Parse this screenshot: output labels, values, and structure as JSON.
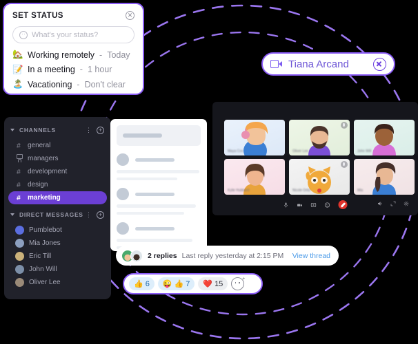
{
  "theme": {
    "background": "#000000",
    "accent_purple": "#8b5cf6",
    "channel_active": "#6b3fd4",
    "sidebar_bg": "#21222b",
    "link_blue": "#4a9ae8",
    "end_call_red": "#e0342c"
  },
  "status_popup": {
    "title": "SET STATUS",
    "close_icon": "close-circle-icon",
    "input": {
      "placeholder": "What's your status?",
      "value": "",
      "icon": "emoji-smile-icon"
    },
    "options": [
      {
        "emoji": "🏡",
        "label": "Working remotely",
        "separator": "-",
        "duration": "Today"
      },
      {
        "emoji": "📝",
        "label": "In a meeting",
        "separator": "-",
        "duration": "1 hour"
      },
      {
        "emoji": "🏝️",
        "label": "Vacationing",
        "separator": "-",
        "duration": "Don't clear"
      }
    ]
  },
  "call_badge": {
    "camera_icon": "video-camera-icon",
    "name": "Tiana Arcand",
    "close_icon": "close-circle-icon"
  },
  "sidebar": {
    "channels_section": {
      "title": "CHANNELS",
      "chevron_icon": "chevron-down-icon",
      "more_icon": "more-vertical-icon",
      "add_icon": "plus-circle-icon",
      "items": [
        {
          "name": "general",
          "icon": "hash-icon",
          "active": false
        },
        {
          "name": "managers",
          "icon": "lock-icon",
          "active": false
        },
        {
          "name": "development",
          "icon": "hash-icon",
          "active": false
        },
        {
          "name": "design",
          "icon": "hash-icon",
          "active": false
        },
        {
          "name": "marketing",
          "icon": "hash-icon",
          "active": true
        }
      ]
    },
    "dm_section": {
      "title": "DIRECT MESSAGES",
      "chevron_icon": "chevron-down-icon",
      "more_icon": "more-vertical-icon",
      "add_icon": "plus-circle-icon",
      "items": [
        {
          "name": "Pumblebot",
          "avatar_color": "#5b6ee0"
        },
        {
          "name": "Mia Jones",
          "avatar_color": "#8c9fbf"
        },
        {
          "name": "Eric Till",
          "avatar_color": "#cbb27a"
        },
        {
          "name": "John Will",
          "avatar_color": "#7c8fa8"
        },
        {
          "name": "Oliver Lee",
          "avatar_color": "#9a8a78"
        }
      ]
    }
  },
  "message_skeleton": {
    "placeholder_rows": 3,
    "note": "loading placeholder message list"
  },
  "thread_bar": {
    "reply_count": "2 replies",
    "last_reply": "Last reply yesterday at 2:15 PM",
    "view_link": "View thread",
    "avatars": [
      "#4aa96c",
      "#d9e3ea"
    ]
  },
  "reactions": {
    "items": [
      {
        "emoji": "👍",
        "emoji2": "",
        "count": "6",
        "style": "blue"
      },
      {
        "emoji": "😜",
        "emoji2": "👍",
        "count": "7",
        "style": "blue"
      },
      {
        "emoji": "❤️",
        "emoji2": "",
        "count": "15",
        "style": "gray"
      }
    ],
    "add_reaction_icon": "add-reaction-icon"
  },
  "video_call": {
    "tiles": [
      {
        "name": "Maya Cox",
        "bg": "#e6f0fb",
        "muted": false
      },
      {
        "name": "Oliver Lee",
        "bg": "#eaf3e4",
        "muted": true
      },
      {
        "name": "John Will",
        "bg": "#e4f3ef",
        "muted": false
      },
      {
        "name": "Kylie Hubbard",
        "bg": "#fbe6ec",
        "muted": false
      },
      {
        "name": "Nicole Ortiz",
        "bg": "#f0f0f0",
        "muted": true
      },
      {
        "name": "Mia",
        "bg": "#f6eaea",
        "muted": false
      }
    ],
    "controls": {
      "left": [
        "microphone-icon",
        "video-camera-icon",
        "screen-share-icon",
        "emoji-icon"
      ],
      "end_call": "end-call-icon",
      "right": [
        "volume-icon",
        "expand-icon",
        "settings-icon"
      ]
    }
  }
}
